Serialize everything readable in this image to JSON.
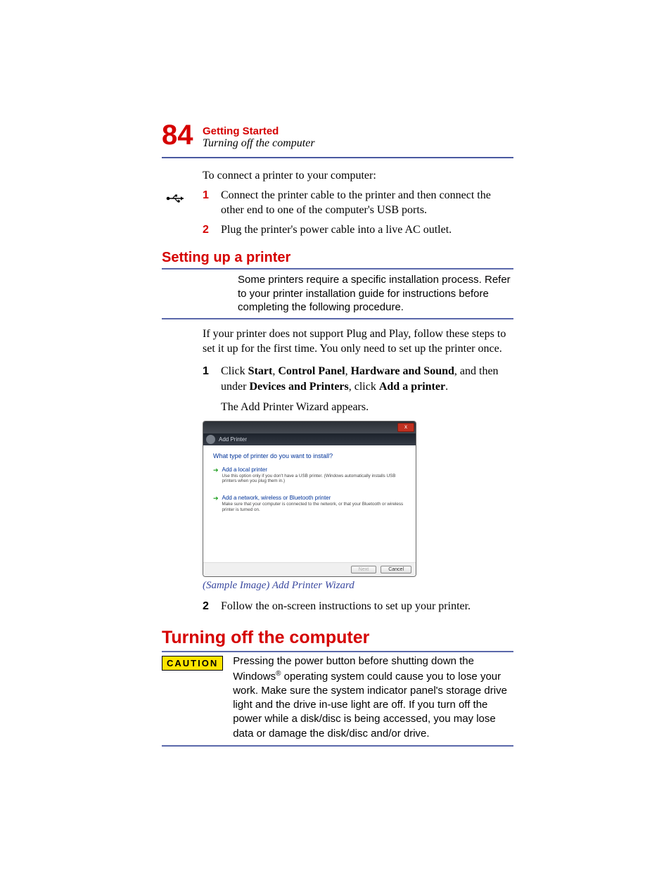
{
  "page_number": "84",
  "header": {
    "chapter": "Getting Started",
    "section": "Turning off the computer"
  },
  "intro": "To connect a printer to your computer:",
  "steps_a": {
    "n1": "1",
    "t1": "Connect the printer cable to the printer and then connect the other end to one of the computer's USB ports.",
    "n2": "2",
    "t2": "Plug the printer's power cable into a live AC outlet."
  },
  "section_setup": "Setting up a printer",
  "note_setup": "Some printers require a specific installation process. Refer to your printer installation guide for instructions before completing the following procedure.",
  "para_plug": "If your printer does not support Plug and Play, follow these steps to set it up for the first time. You only need to set up the printer once.",
  "steps_b": {
    "n1": "1",
    "t1_a": "Click ",
    "t1_b1": "Start",
    "sep1": ", ",
    "t1_b2": "Control Panel",
    "sep2": ", ",
    "t1_b3": "Hardware and Sound",
    "t1_c": ", and then under ",
    "t1_b4": "Devices and Printers",
    "t1_d": ", click ",
    "t1_b5": "Add a printer",
    "t1_e": ".",
    "t1_follow": "The Add Printer Wizard appears.",
    "n2": "2",
    "t2": "Follow the on-screen instructions to set up your printer."
  },
  "wizard": {
    "close": "x",
    "breadcrumb": "Add Printer",
    "question": "What type of printer do you want to install?",
    "opt1_title": "Add a local printer",
    "opt1_desc": "Use this option only if you don't have a USB printer. (Windows automatically installs USB printers when you plug them in.)",
    "opt2_title": "Add a network, wireless or Bluetooth printer",
    "opt2_desc": "Make sure that your computer is connected to the network, or that your Bluetooth or wireless printer is turned on.",
    "next": "Next",
    "cancel": "Cancel"
  },
  "caption": "(Sample Image) Add Printer Wizard",
  "section_turnoff": "Turning off the computer",
  "caution_label": "CAUTION",
  "caution_a": "Pressing the power button before shutting down the Windows",
  "caution_reg": "®",
  "caution_b": " operating system could cause you to lose your work. Make sure the system indicator panel's storage drive light and the drive in-use light are off. If you turn off the power while a disk/disc is being accessed, you may lose data or damage the disk/disc and/or drive."
}
